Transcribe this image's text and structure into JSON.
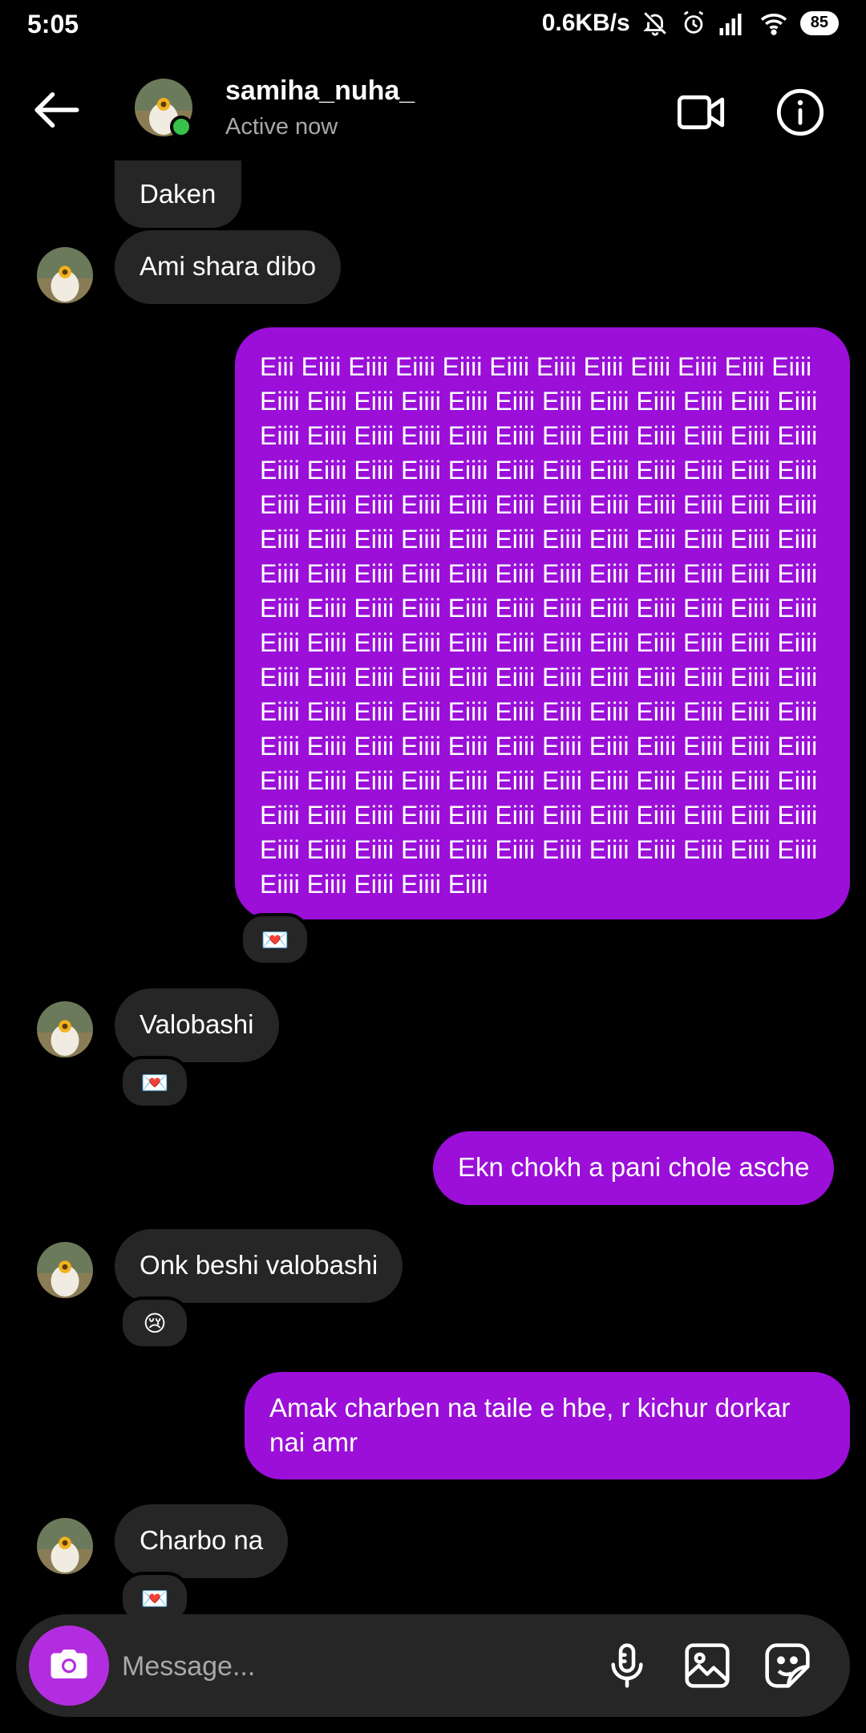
{
  "status_bar": {
    "time": "5:05",
    "network_speed": "0.6KB/s",
    "battery": "85",
    "icons": [
      "bell-muted-icon",
      "alarm-icon",
      "signal-icon",
      "wifi-icon",
      "battery-icon"
    ]
  },
  "header": {
    "username": "samiha_nuha_",
    "status": "Active now",
    "online_color": "#37c24a",
    "icons": [
      "back-arrow-icon",
      "video-call-icon",
      "info-icon"
    ]
  },
  "colors": {
    "background": "#000000",
    "incoming_bubble": "#262626",
    "outgoing_bubble": "#9b0fd9",
    "camera_button": "#b32de0"
  },
  "messages": [
    {
      "direction": "incoming",
      "text": "Daken"
    },
    {
      "direction": "incoming",
      "text": "Ami shara dibo"
    },
    {
      "direction": "outgoing",
      "text": "Eiii Eiiii Eiiii Eiiii Eiiii Eiiii Eiiii Eiiii Eiiii Eiiii Eiiii Eiiii Eiiii Eiiii Eiiii Eiiii Eiiii Eiiii Eiiii Eiiii Eiiii Eiiii Eiiii Eiiii Eiiii Eiiii Eiiii Eiiii Eiiii Eiiii Eiiii Eiiii Eiiii Eiiii Eiiii Eiiii Eiiii Eiiii Eiiii Eiiii Eiiii Eiiii Eiiii Eiiii Eiiii Eiiii Eiiii Eiiii Eiiii Eiiii Eiiii Eiiii Eiiii Eiiii Eiiii Eiiii Eiiii Eiiii Eiiii Eiiii Eiiii Eiiii Eiiii Eiiii Eiiii Eiiii Eiiii Eiiii Eiiii Eiiii Eiiii Eiiii Eiiii Eiiii Eiiii Eiiii Eiiii Eiiii Eiiii Eiiii Eiiii Eiiii Eiiii Eiiii Eiiii Eiiii Eiiii Eiiii Eiiii Eiiii Eiiii Eiiii Eiiii Eiiii Eiiii Eiiii Eiiii Eiiii Eiiii Eiiii Eiiii Eiiii Eiiii Eiiii Eiiii Eiiii Eiiii Eiiii Eiiii Eiiii Eiiii Eiiii Eiiii Eiiii Eiiii Eiiii Eiiii Eiiii Eiiii Eiiii Eiiii Eiiii Eiiii Eiiii Eiiii Eiiii Eiiii Eiiii Eiiii Eiiii Eiiii Eiiii Eiiii Eiiii Eiiii Eiiii Eiiii Eiiii Eiiii Eiiii Eiiii Eiiii Eiiii Eiiii Eiiii Eiiii Eiiii Eiiii Eiiii Eiiii Eiiii Eiiii Eiiii Eiiii Eiiii Eiiii Eiiii Eiiii Eiiii Eiiii Eiiii Eiiii Eiiii Eiiii Eiiii Eiiii Eiiii Eiiii Eiiii Eiiii Eiiii Eiiii Eiiii Eiiii Eiiii Eiiii Eiiii Eiiii Eiiii Eiiii Eiiii Eiiii Eiiii Eiiii Eiiii",
      "reaction": "💌"
    },
    {
      "direction": "incoming",
      "text": "Valobashi",
      "reaction": "💌"
    },
    {
      "direction": "outgoing",
      "text": "Ekn chokh a pani chole asche"
    },
    {
      "direction": "incoming",
      "text": "Onk beshi valobashi",
      "reaction": "😢"
    },
    {
      "direction": "outgoing",
      "text": "Amak charben na taile e hbe, r kichur dorkar nai amr"
    },
    {
      "direction": "incoming",
      "text": "Charbo na",
      "reaction": "💌"
    }
  ],
  "composer": {
    "placeholder": "Message...",
    "icons": [
      "camera-icon",
      "microphone-icon",
      "gallery-icon",
      "sticker-icon"
    ]
  }
}
